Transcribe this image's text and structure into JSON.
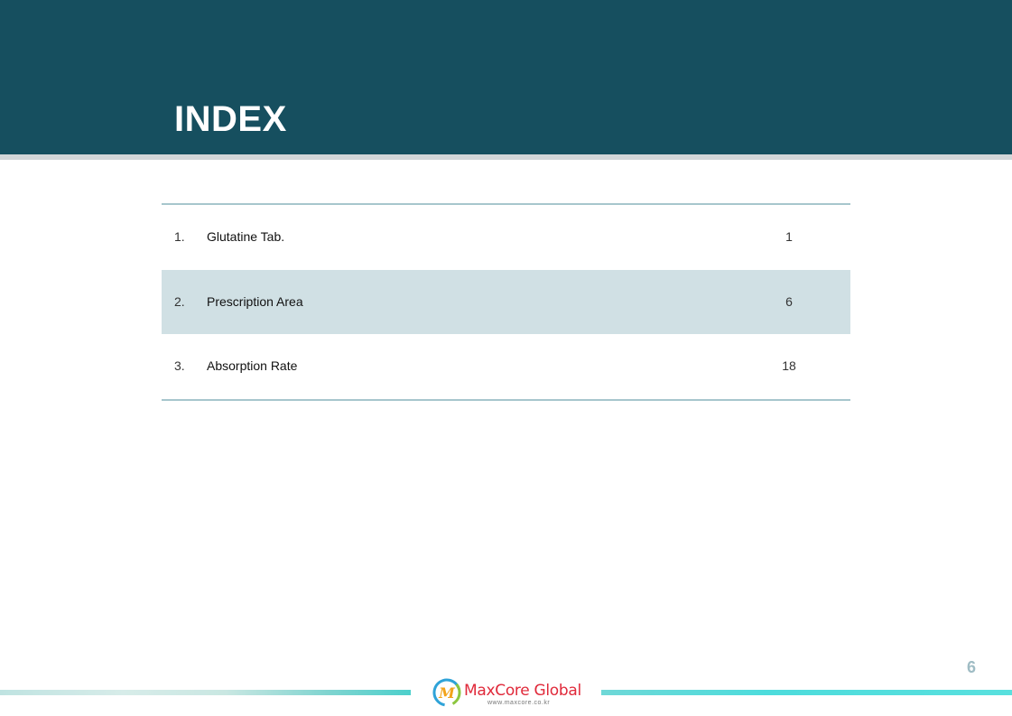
{
  "title": "INDEX",
  "toc": {
    "rows": [
      {
        "number": "1.",
        "label": "Glutatine Tab.",
        "page": "1"
      },
      {
        "number": "2.",
        "label": "Prescription Area",
        "page": "6"
      },
      {
        "number": "3.",
        "label": "Absorption Rate",
        "page": "18"
      }
    ]
  },
  "page_number": "6",
  "footer": {
    "logo_text": "MaxCore Global",
    "logo_url": "www.maxcore.co.kr"
  },
  "colors": {
    "header": "#164f5f",
    "row_shade": "#d0e0e4",
    "rule": "#a7c6cd",
    "logo_red": "#e0293a"
  }
}
